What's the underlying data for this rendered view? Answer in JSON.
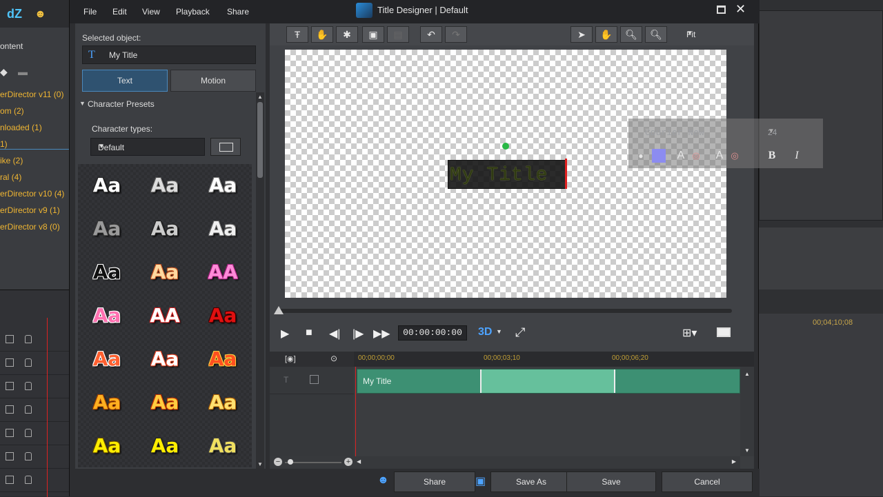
{
  "background_app": {
    "logo": "dZ",
    "library_title": "ontent",
    "library_items": [
      "erDirector v11  (0)",
      "om  (2)",
      "nloaded  (1)",
      "1)",
      "ike  (2)",
      "ral  (4)",
      "erDirector v10  (4)",
      "erDirector v9  (1)",
      "erDirector v8  (0)"
    ],
    "timeline_time": "00;04;10;08"
  },
  "menu": [
    "File",
    "Edit",
    "View",
    "Playback",
    "Share"
  ],
  "window": {
    "title": "Title Designer  |  Default"
  },
  "left_panel": {
    "selected_label": "Selected object:",
    "selected_value": "My Title",
    "selected_icon": "T",
    "tabs": [
      "Text",
      "Motion"
    ],
    "section_title": "Character Presets",
    "char_types_label": "Character types:",
    "char_types_value": "Default",
    "preset_sample": "Aa",
    "presets": [
      {
        "text": "Aa",
        "fill": "#ffffff",
        "stroke": "#222222"
      },
      {
        "text": "Aa",
        "fill": "#dddddd",
        "stroke": "#555555"
      },
      {
        "text": "Aa",
        "fill": "#ffffff",
        "stroke": "#777777"
      },
      {
        "text": "Aa",
        "fill": "#9a9a9a",
        "stroke": "#333333"
      },
      {
        "text": "Aa",
        "fill": "#cccccc",
        "stroke": "#222222"
      },
      {
        "text": "Aa",
        "fill": "#f0f0f0",
        "stroke": "#666666"
      },
      {
        "text": "Aa",
        "fill": "#111111",
        "stroke": "#ffffff"
      },
      {
        "text": "Aa",
        "fill": "#ffd9a0",
        "stroke": "#c05020"
      },
      {
        "text": "AA",
        "fill": "#ff8ad8",
        "stroke": "#a0207a"
      },
      {
        "text": "Aa",
        "fill": "#ff70b0",
        "stroke": "#ffffff"
      },
      {
        "text": "AA",
        "fill": "#ffffff",
        "stroke": "#d02020"
      },
      {
        "text": "Aa",
        "fill": "#e01010",
        "stroke": "#400000"
      },
      {
        "text": "Aa",
        "fill": "#ff6030",
        "stroke": "#ffffff"
      },
      {
        "text": "Aa",
        "fill": "#ffffff",
        "stroke": "#e04020"
      },
      {
        "text": "Aa",
        "fill": "#ff5020",
        "stroke": "#ffd040"
      },
      {
        "text": "Aa",
        "fill": "#ffb020",
        "stroke": "#a04000"
      },
      {
        "text": "Aa",
        "fill": "#ffcc40",
        "stroke": "#c03000"
      },
      {
        "text": "Aa",
        "fill": "#ffe070",
        "stroke": "#b06000"
      },
      {
        "text": "Aa",
        "fill": "#ffee00",
        "stroke": "#6a5000"
      },
      {
        "text": "Aa",
        "fill": "#ffee00",
        "stroke": "#222222"
      },
      {
        "text": "Aa",
        "fill": "#f0e060",
        "stroke": "#444444"
      }
    ]
  },
  "toolbar": {
    "zoom_value": "Fit"
  },
  "canvas": {
    "title_text": "My Title",
    "font_name": "Courier New",
    "font_size": "24",
    "bold_label": "B",
    "italic_label": "I"
  },
  "playback": {
    "timecode": "00:00:00:00",
    "mode_3d": "3D"
  },
  "timeline": {
    "ticks": [
      "00;00;00;00",
      "00;00;03;10",
      "00;00;06;20"
    ],
    "clip_label": "My Title",
    "track_label": "T"
  },
  "bottom": {
    "share": "Share",
    "save_as": "Save As",
    "save": "Save",
    "cancel": "Cancel"
  },
  "colors": {
    "accent_blue": "#4da3ff",
    "clip_green": "#3d9073",
    "playhead_red": "#dd2222"
  }
}
